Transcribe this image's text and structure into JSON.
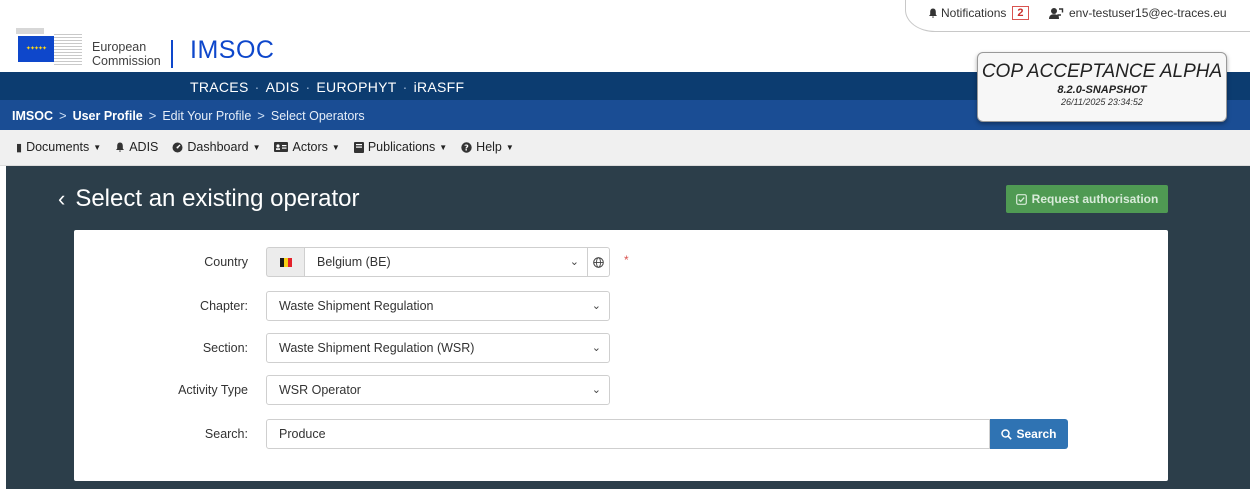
{
  "header": {
    "org_line1": "European",
    "org_line2": "Commission",
    "app_name": "IMSOC",
    "systems": [
      "TRACES",
      "ADIS",
      "EUROPHYT",
      "iRASFF"
    ],
    "notifications_label": "Notifications",
    "notifications_count": "2",
    "user_email": "env-testuser15@ec-traces.eu"
  },
  "environment": {
    "title": "COP ACCEPTANCE ALPHA",
    "version": "8.2.0-SNAPSHOT",
    "datetime": "26/11/2025 23:34:52"
  },
  "breadcrumb": {
    "root": "IMSOC",
    "user_profile": "User Profile",
    "edit_profile": "Edit Your Profile",
    "select_operators": "Select Operators"
  },
  "menu": {
    "documents": "Documents",
    "adis": "ADIS",
    "dashboard": "Dashboard",
    "actors": "Actors",
    "publications": "Publications",
    "help": "Help"
  },
  "page": {
    "title": "Select an existing operator",
    "request_button": "Request authorisation"
  },
  "form": {
    "country_label": "Country",
    "country_value": "Belgium (BE)",
    "required_mark": "*",
    "chapter_label": "Chapter:",
    "chapter_value": "Waste Shipment Regulation",
    "section_label": "Section:",
    "section_value": "Waste Shipment Regulation (WSR)",
    "activity_label": "Activity Type",
    "activity_value": "WSR Operator",
    "search_label": "Search:",
    "search_value": "Produce",
    "search_button": "Search"
  },
  "colors": {
    "brand_blue": "#0e47cb",
    "systems_bar": "#0c3c70",
    "breadcrumb_bar": "#1a4d94",
    "main_background": "#2c3e4a",
    "request_button": "#4f9a53",
    "search_button": "#2f73b3",
    "required": "#d9534f"
  }
}
